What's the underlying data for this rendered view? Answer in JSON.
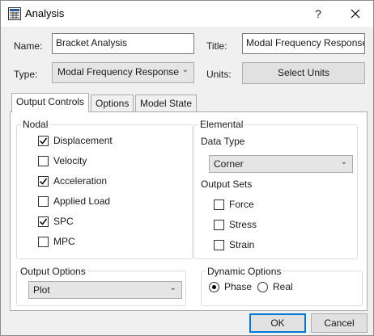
{
  "window": {
    "title": "Analysis",
    "help": "?",
    "close": "✕"
  },
  "form": {
    "name_label": "Name:",
    "name_value": "Bracket Analysis",
    "title_label": "Title:",
    "title_value": "Modal Frequency Response",
    "type_label": "Type:",
    "type_value": "Modal Frequency Response",
    "units_label": "Units:",
    "units_button": "Select Units"
  },
  "tabs": [
    {
      "label": "Output Controls",
      "active": true
    },
    {
      "label": "Options",
      "active": false
    },
    {
      "label": "Model State",
      "active": false
    }
  ],
  "nodal": {
    "title": "Nodal",
    "items": [
      {
        "label": "Displacement",
        "checked": true
      },
      {
        "label": "Velocity",
        "checked": false
      },
      {
        "label": "Acceleration",
        "checked": true
      },
      {
        "label": "Applied Load",
        "checked": false
      },
      {
        "label": "SPC",
        "checked": true
      },
      {
        "label": "MPC",
        "checked": false
      }
    ]
  },
  "elemental": {
    "title": "Elemental",
    "data_type_label": "Data Type",
    "data_type_value": "Corner",
    "output_sets_label": "Output Sets",
    "items": [
      {
        "label": "Force",
        "checked": false
      },
      {
        "label": "Stress",
        "checked": false
      },
      {
        "label": "Strain",
        "checked": false
      }
    ]
  },
  "output_options": {
    "title": "Output Options",
    "value": "Plot"
  },
  "dynamic_options": {
    "title": "Dynamic Options",
    "phase_label": "Phase",
    "real_label": "Real",
    "selected": "Phase"
  },
  "footer": {
    "ok_label": "OK",
    "cancel_label": "Cancel"
  }
}
